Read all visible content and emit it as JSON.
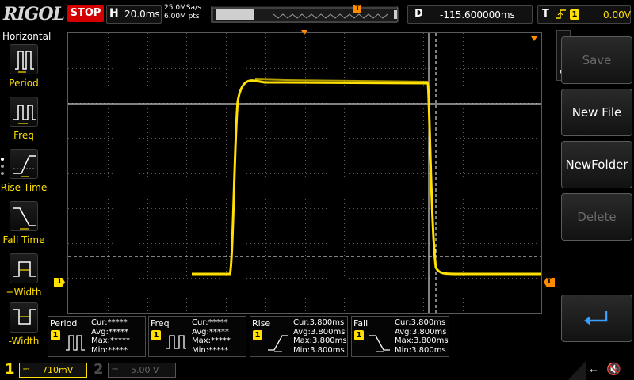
{
  "header": {
    "logo": "RIGOL",
    "run_state": "STOP",
    "horizontal": {
      "letter": "H",
      "timebase": "20.0ms"
    },
    "sample": {
      "rate": "25.0MSa/s",
      "depth": "6.00M pts"
    },
    "memory_trigger_marker": "T",
    "delay": {
      "letter": "D",
      "value": "-115.600000ms"
    },
    "trigger": {
      "letter": "T",
      "edge": "rising-edge-icon",
      "source": "1",
      "level": "0.00V"
    }
  },
  "left_panel": {
    "title": "Horizontal",
    "items": [
      {
        "label": "Period",
        "icon": "period-icon"
      },
      {
        "label": "Freq",
        "icon": "frequency-icon"
      },
      {
        "label": "Rise Time",
        "icon": "rise-time-icon"
      },
      {
        "label": "Fall Time",
        "icon": "fall-time-icon"
      },
      {
        "label": "+Width",
        "icon": "positive-width-icon"
      },
      {
        "label": "-Width",
        "icon": "negative-width-icon"
      }
    ]
  },
  "screen": {
    "ch1_marker": "1",
    "trigger_level_marker": "T"
  },
  "right_panel": {
    "menu_title": "Save",
    "keys": [
      {
        "label": "Save",
        "enabled": false
      },
      {
        "label": "New File",
        "enabled": true
      },
      {
        "label": "NewFolder",
        "enabled": true
      },
      {
        "label": "Delete",
        "enabled": false
      }
    ],
    "back_icon": "return-arrow-icon"
  },
  "measurements": [
    {
      "name": "Period",
      "channel": "1",
      "icon": "period-icon",
      "cur": "Cur:*****",
      "avg": "Avg:*****",
      "max": "Max:*****",
      "min": "Min:*****"
    },
    {
      "name": "Freq",
      "channel": "1",
      "icon": "frequency-icon",
      "cur": "Cur:*****",
      "avg": "Avg:*****",
      "max": "Max:*****",
      "min": "Min:*****"
    },
    {
      "name": "Rise",
      "channel": "1",
      "icon": "rise-time-icon",
      "cur": "Cur:3.800ms",
      "avg": "Avg:3.800ms",
      "max": "Max:3.800ms",
      "min": "Min:3.800ms"
    },
    {
      "name": "Fall",
      "channel": "1",
      "icon": "fall-time-icon",
      "cur": "Cur:3.800ms",
      "avg": "Avg:3.800ms",
      "max": "Max:3.800ms",
      "min": "Min:3.800ms"
    }
  ],
  "channels": [
    {
      "num": "1",
      "coupling": "DC",
      "scale": "710mV",
      "active": true
    },
    {
      "num": "2",
      "coupling": "DC",
      "scale": "5.00 V",
      "active": false
    }
  ],
  "status": {
    "usb_icon": "usb-icon",
    "speaker_icon": "speaker-muted-icon"
  },
  "colors": {
    "ch1": "#ffe000",
    "stop": "#d40000",
    "trigger_marker": "#ff8c00",
    "grid": "#5a5a5a"
  }
}
